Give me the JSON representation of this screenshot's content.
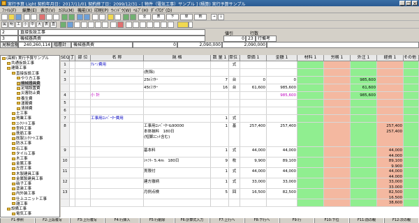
{
  "window": {
    "title": "実行予算 Light  契約年月日：2017/11/01  契約終了日：2099/12/31  - [ 物件（電気工事）サンプル ]  (積算) 実行予算サンプル"
  },
  "menu": [
    "ﾌｧｲﾙ(F)",
    "編集(E)",
    "表示(V)",
    "ｶｽﾀﾑ(M)",
    "機能(X)",
    "印刷(P)",
    "ｳｨﾝﾄﾞｳ(W)",
    "ﾍﾙﾌﾟ(H)",
    "ﾀﾞｲｱﾛｸﾞ(D)"
  ],
  "toolbar2": {
    "kanji_buttons": [
      "全",
      "表",
      "下",
      "単",
      "剤",
      "→",
      "↓"
    ]
  },
  "toolbar3": {
    "labels": [
      "属",
      "明",
      "工",
      "小",
      "中",
      "大",
      "表",
      "直"
    ]
  },
  "info": {
    "row1_no": "2",
    "row1_name": "直接仮設工事",
    "row2_no": "3",
    "row2_name": "機械器具費",
    "neebiki_label": "値引",
    "neebiki_value": "0",
    "gyosu_label": "行数",
    "gyosu_value": "23",
    "gyosu_note": "行備考",
    "summary_label1": "見積金額",
    "summary_value1": "240,260,114",
    "summary_label2": "階層計",
    "summary_label3": "機械器具費",
    "summary_value3": "0",
    "summary_value4": "2,090,000",
    "summary_value5": "2,090,000"
  },
  "tree": [
    {
      "label": "(高柳) 実行予算サンプル",
      "depth": 0
    },
    {
      "label": "共通仮設工事",
      "depth": 1
    },
    {
      "label": "建築工事",
      "depth": 1
    },
    {
      "label": "直接仮設工事",
      "depth": 2
    },
    {
      "label": "やり方工事",
      "depth": 3
    },
    {
      "label": "機械器具費",
      "depth": 3,
      "selected": true
    },
    {
      "label": "足場設置費",
      "depth": 3
    },
    {
      "label": "災害防止費",
      "depth": 3
    },
    {
      "label": "養生費",
      "depth": 3
    },
    {
      "label": "運搬費",
      "depth": 3
    },
    {
      "label": "清掃費",
      "depth": 3
    },
    {
      "label": "土工事",
      "depth": 2
    },
    {
      "label": "地業工事",
      "depth": 2
    },
    {
      "label": "ｺﾝｸﾘｰﾄ工事",
      "depth": 2
    },
    {
      "label": "型枠工事",
      "depth": 2
    },
    {
      "label": "鉄筋工事",
      "depth": 2
    },
    {
      "label": "既製ｺﾝｸﾘｰﾄ工事",
      "depth": 2
    },
    {
      "label": "防水工事",
      "depth": 2
    },
    {
      "label": "石工事",
      "depth": 2
    },
    {
      "label": "タイル工事",
      "depth": 2
    },
    {
      "label": "木工事",
      "depth": 2
    },
    {
      "label": "金属工事",
      "depth": 2
    },
    {
      "label": "左官工事",
      "depth": 2
    },
    {
      "label": "木製建具工事",
      "depth": 2
    },
    {
      "label": "金属製建具工事",
      "depth": 2
    },
    {
      "label": "硝子工事",
      "depth": 2
    },
    {
      "label": "塗装工事",
      "depth": 2
    },
    {
      "label": "内外装工事",
      "depth": 2
    },
    {
      "label": "仕上ユニット工事",
      "depth": 2
    },
    {
      "label": "雑工事",
      "depth": 2
    },
    {
      "label": "設備工事",
      "depth": 1
    },
    {
      "label": "電気工事",
      "depth": 2
    }
  ],
  "grid": {
    "headers": [
      "SEQ",
      "丁",
      "部 位",
      "名 称",
      "規 格",
      "数 量 1",
      "単位 1",
      "単価 1",
      "金額 1",
      "材料 1",
      "労務 1",
      "外注 1",
      "経費 1",
      "その他 1"
    ],
    "rows": [
      {
        "seq": "1",
        "name": "ｸﾚｰﾝ費用",
        "spec": "",
        "qty": "",
        "unit": "式",
        "price": "",
        "amount": "",
        "zai": "",
        "romu": "",
        "gaichu": "",
        "keihi": "",
        "sonota": "",
        "kind": "head"
      },
      {
        "seq": "2",
        "name": "",
        "spec": "(削除)",
        "qty": "",
        "unit": "",
        "price": "",
        "amount": "",
        "zai": "",
        "romu": "",
        "gaichu": "",
        "keihi": "",
        "sonota": "",
        "kind": "plain"
      },
      {
        "seq": "3",
        "name": "",
        "spec": "25tﾗﾌﾀｰ",
        "qty": "7",
        "unit": "台",
        "price": "0",
        "amount": "0",
        "zai": "",
        "romu": "",
        "gaichu": "985,600",
        "keihi": "",
        "sonota": "",
        "kind": "plain"
      },
      {
        "seq": "",
        "name": "",
        "spec": "45tﾗﾌﾀｰ",
        "qty": "16",
        "unit": "台",
        "price": "61,600",
        "amount": "985,600",
        "zai": "",
        "romu": "",
        "gaichu": "61,600",
        "keihi": "",
        "sonota": "",
        "kind": "plain"
      },
      {
        "seq": "4",
        "name": "小 計",
        "spec": "",
        "qty": "",
        "unit": "",
        "price": "",
        "amount": "985,600",
        "zai": "",
        "romu": "",
        "gaichu": "985,600",
        "keihi": "",
        "sonota": "",
        "kind": "sub"
      },
      {
        "seq": "5",
        "name": "",
        "spec": "",
        "qty": "",
        "unit": "",
        "price": "",
        "amount": "",
        "zai": "",
        "romu": "",
        "gaichu": "",
        "keihi": "",
        "sonota": "",
        "kind": "plain"
      },
      {
        "seq": "6",
        "name": "",
        "spec": "",
        "qty": "",
        "unit": "",
        "price": "",
        "amount": "",
        "zai": "",
        "romu": "",
        "gaichu": "",
        "keihi": "",
        "sonota": "",
        "kind": "plain"
      },
      {
        "seq": "7",
        "name": "工事用ｴﾚﾍﾞｰﾀｰ費用",
        "spec": "",
        "qty": "1",
        "unit": "式",
        "price": "",
        "amount": "",
        "zai": "",
        "romu": "",
        "gaichu": "",
        "keihi": "",
        "sonota": "",
        "kind": "head"
      },
      {
        "seq": "8",
        "name": "",
        "spec": "工事用ｴﾚﾍﾞｰﾀｰ&90000\n本体損料　180日\n(短脚ﾕﾆｯﾄ含む)",
        "qty": "1",
        "unit": "基",
        "price": "257,400",
        "amount": "257,400",
        "zai": "",
        "romu": "",
        "gaichu": "",
        "keihi": "257,400\n257,400",
        "sonota": "",
        "kind": "tall"
      },
      {
        "seq": "9",
        "name": "",
        "spec": "基本料",
        "qty": "1",
        "unit": "式",
        "price": "44,000",
        "amount": "44,000",
        "zai": "",
        "romu": "",
        "gaichu": "",
        "keihi": "44,000\n44,000",
        "sonota": "",
        "kind": "mid"
      },
      {
        "seq": "10",
        "name": "",
        "spec": "ｼｬﾌﾄ- 5.4m　180日",
        "qty": "9",
        "unit": "枚",
        "price": "9,900",
        "amount": "89,100",
        "zai": "",
        "romu": "",
        "gaichu": "",
        "keihi": "89,100\n9,900",
        "sonota": "",
        "kind": "mid"
      },
      {
        "seq": "11",
        "name": "",
        "spec": "貫限付",
        "qty": "1",
        "unit": "式",
        "price": "44,000",
        "amount": "44,000",
        "zai": "",
        "romu": "",
        "gaichu": "",
        "keihi": "44,000\n44,000",
        "sonota": "",
        "kind": "mid"
      },
      {
        "seq": "12",
        "name": "",
        "spec": "建方撤柄",
        "qty": "1",
        "unit": "式",
        "price": "33,000",
        "amount": "33,000",
        "zai": "",
        "romu": "",
        "gaichu": "",
        "keihi": "33,000\n33,000",
        "sonota": "",
        "kind": "mid"
      },
      {
        "seq": "13",
        "name": "",
        "spec": "月例点検",
        "qty": "5",
        "unit": "回",
        "price": "16,500",
        "amount": "82,500",
        "zai": "",
        "romu": "",
        "gaichu": "",
        "keihi": "82,500\n16,500",
        "sonota": "",
        "kind": "mid"
      },
      {
        "seq": "",
        "name": "",
        "spec": "",
        "qty": "",
        "unit": "",
        "price": "",
        "amount": "",
        "zai": "",
        "romu": "",
        "gaichu": "",
        "keihi": "38,600",
        "sonota": "",
        "kind": "plain"
      }
    ]
  },
  "statusbar": [
    "F1:参照",
    "F2:上段複写",
    "F3:上行複写",
    "F4:行挿入",
    "F5:行削除",
    "F6:計算式入力",
    "F7:上行へ",
    "F8:下行へ",
    "F9:行",
    "F10:下位",
    "F11:前の親",
    "F12:次の親"
  ],
  "colors": {
    "band_green": "#90ee90",
    "band_salmon": "#f4b8a0",
    "accent_blue": "#2a5a92",
    "text_blue": "#0000c0",
    "text_magenta": "#c000c0"
  }
}
